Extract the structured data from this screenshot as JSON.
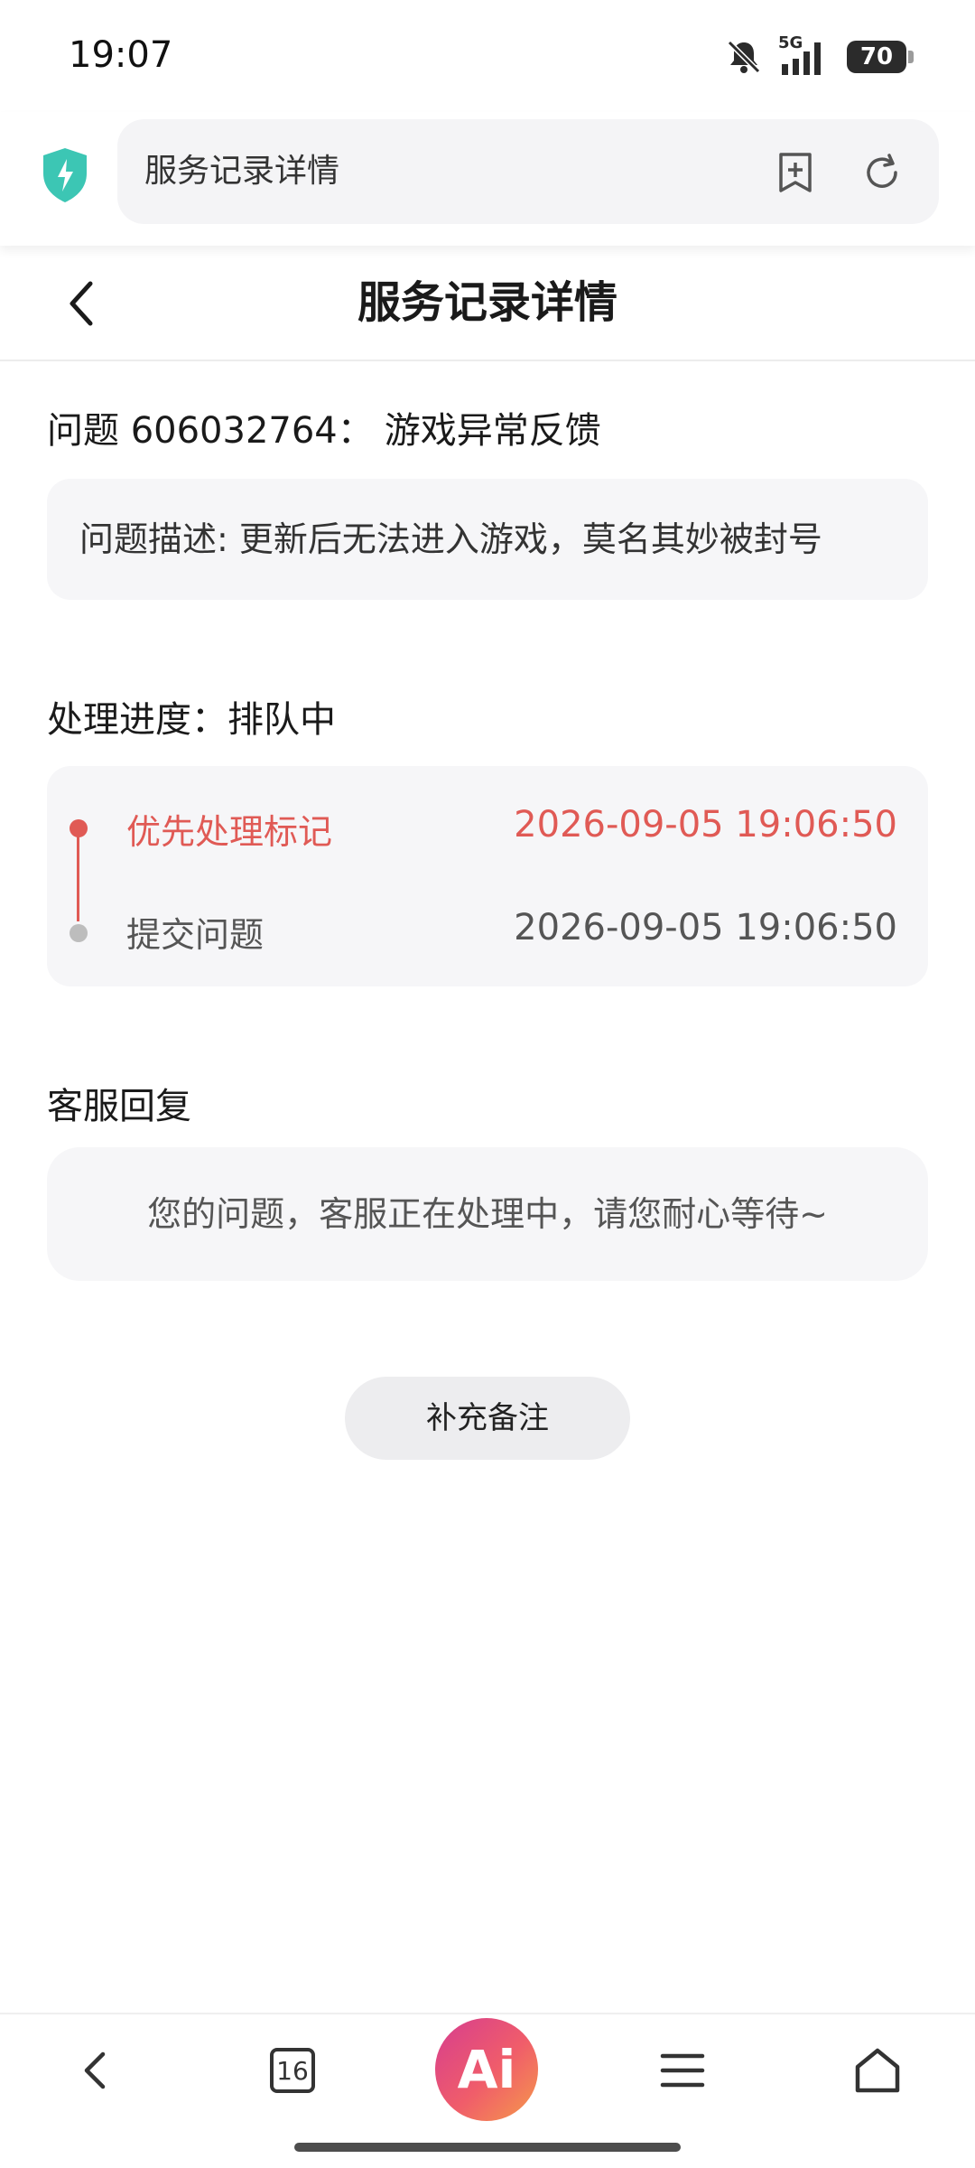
{
  "status_bar": {
    "time": "19:07",
    "network": "5G",
    "battery_level": "70"
  },
  "browser": {
    "address_text": "服务记录详情"
  },
  "header": {
    "title": "服务记录详情"
  },
  "issue": {
    "label": "问题 606032764：",
    "category": "游戏异常反馈",
    "description": "问题描述: 更新后无法进入游戏，莫名其妙被封号"
  },
  "progress": {
    "heading": "处理进度：排队中",
    "steps": [
      {
        "label": "优先处理标记",
        "time": "2026-09-05 19:06:50"
      },
      {
        "label": "提交问题",
        "time": "2026-09-05 19:06:50"
      }
    ]
  },
  "reply": {
    "heading": "客服回复",
    "text": "您的问题，客服正在处理中，请您耐心等待~"
  },
  "actions": {
    "add_note_label": "补充备注"
  },
  "bottom_nav": {
    "tab_count": "16",
    "ai_label": "Ai"
  },
  "colors": {
    "accent_red": "#e05a55",
    "card_bg": "#f6f6f8",
    "shield": "#3cc6b4"
  }
}
